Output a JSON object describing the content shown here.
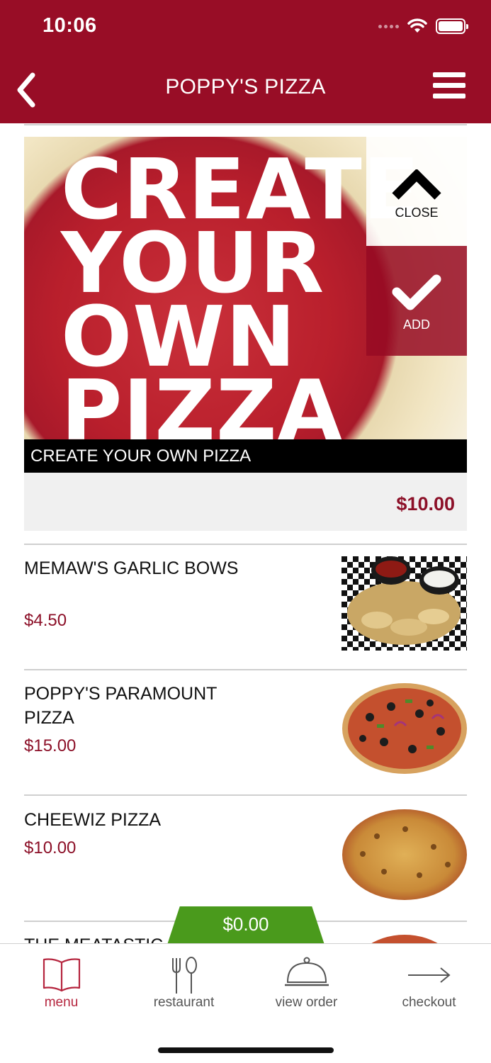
{
  "status_bar": {
    "time": "10:06"
  },
  "header": {
    "title": "POPPY'S PIZZA"
  },
  "featured": {
    "hero_text": [
      "CREATE",
      "YOUR",
      "OWN",
      "PIZZA"
    ],
    "close_label": "CLOSE",
    "add_label": "ADD",
    "name": "CREATE YOUR OWN PIZZA",
    "price": "$10.00"
  },
  "items": [
    {
      "name": "MEMAW'S GARLIC BOWS",
      "price": "$4.50"
    },
    {
      "name": "POPPY'S PARAMOUNT PIZZA",
      "price": "$15.00"
    },
    {
      "name": "CHEEWIZ PIZZA",
      "price": "$10.00"
    },
    {
      "name": "THE MEATASTIC"
    }
  ],
  "cart": {
    "total": "$0.00"
  },
  "tabbar": {
    "tabs": [
      {
        "label": "menu",
        "icon": "book-icon",
        "active": true
      },
      {
        "label": "restaurant",
        "icon": "fork-spoon-icon"
      },
      {
        "label": "view order",
        "icon": "cloche-icon"
      },
      {
        "label": "checkout",
        "icon": "arrow-right-icon"
      }
    ]
  },
  "colors": {
    "brand": "#980d26",
    "price": "#8c1028",
    "cart": "#4a9a1c",
    "active_tab": "#b5253e"
  }
}
